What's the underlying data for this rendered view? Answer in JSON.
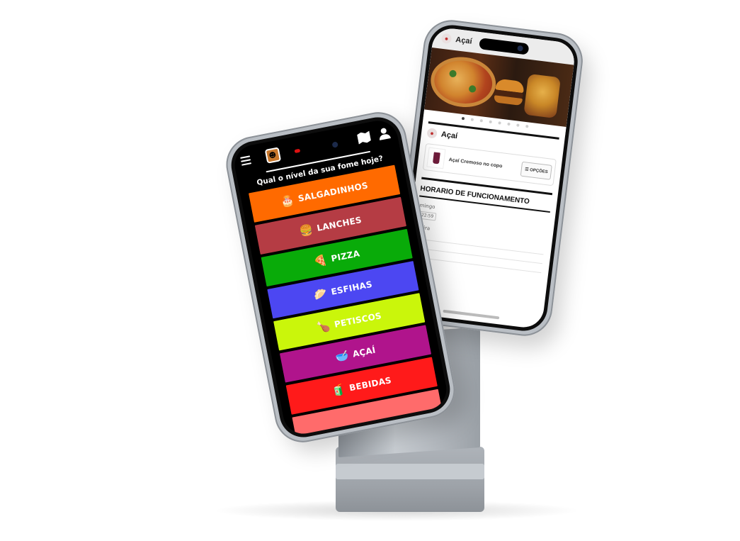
{
  "front_screen": {
    "question": "Qual o nível da sua fome hoje?",
    "icons": {
      "menu": "hamburger-menu-icon",
      "logo": "restaurant-logo",
      "map": "map-icon",
      "account": "user-lock-icon"
    },
    "categories": [
      {
        "label": "SALGADINHOS",
        "icon": "🎂",
        "color": "#ff6a00"
      },
      {
        "label": "LANCHES",
        "icon": "🍔",
        "color": "#b53c44"
      },
      {
        "label": "PIZZA",
        "icon": "🍕",
        "color": "#09ab09"
      },
      {
        "label": "ESFIHAS",
        "icon": "🥟",
        "color": "#4c47f2"
      },
      {
        "label": "PETISCOS",
        "icon": "🍗",
        "color": "#caf60b"
      },
      {
        "label": "AÇAÍ",
        "icon": "🥣",
        "color": "#b0148c"
      },
      {
        "label": "BEBIDAS",
        "icon": "🧃",
        "color": "#ff1a1a"
      },
      {
        "label": "",
        "icon": "",
        "color": "#ff6b6b"
      }
    ]
  },
  "back_screen": {
    "header_title": "Açaí",
    "section_title": "Açaí",
    "product_name": "Açaí Cremoso no copo",
    "options_button": "☰ OPÇÕES",
    "hours_title": "HORARIO DE FUNCIONAMENTO",
    "hours_rows": [
      "mingo",
      "-feira"
    ],
    "hours_chip": "22:59",
    "carousel_dots": 8,
    "carousel_active": 0
  }
}
